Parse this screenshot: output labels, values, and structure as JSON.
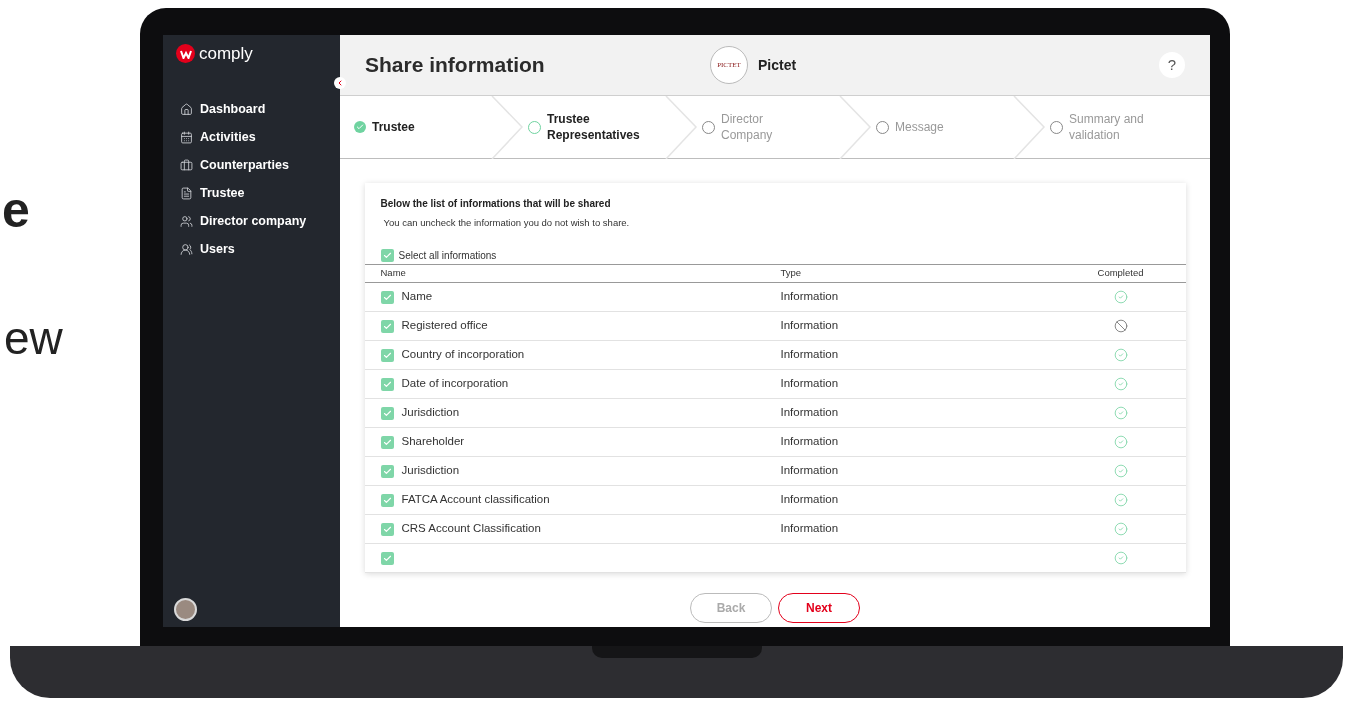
{
  "backdrop_text": [
    "e",
    "ew"
  ],
  "app": {
    "logo_text": "comply"
  },
  "sidebar": {
    "items": [
      {
        "label": "Dashboard"
      },
      {
        "label": "Activities"
      },
      {
        "label": "Counterparties"
      },
      {
        "label": "Trustee"
      },
      {
        "label": "Director company"
      },
      {
        "label": "Users"
      }
    ]
  },
  "header": {
    "title": "Share information",
    "client_logo_text": "PICTET",
    "client_name": "Pictet",
    "help": "?"
  },
  "steps": [
    {
      "label": "Trustee",
      "completed": true,
      "selected": false
    },
    {
      "label": "Trustee Representatives",
      "completed": false,
      "selected": true
    },
    {
      "label": "Director Company",
      "completed": false,
      "selected": false
    },
    {
      "label": "Message",
      "completed": false,
      "selected": false
    },
    {
      "label": "Summary and validation",
      "completed": false,
      "selected": false
    }
  ],
  "card": {
    "title": "Below the list of informations that will be shared",
    "subtitle": "You can uncheck the information you do not wish to share.",
    "select_all": {
      "label": "Select all informations",
      "checked": true
    }
  },
  "table": {
    "columns": [
      "Name",
      "Type",
      "Completed"
    ],
    "rows": [
      {
        "name": "Name",
        "type": "Information",
        "checked": true,
        "completed": true
      },
      {
        "name": "Registered office",
        "type": "Information",
        "checked": true,
        "completed": false
      },
      {
        "name": "Country of incorporation",
        "type": "Information",
        "checked": true,
        "completed": true
      },
      {
        "name": "Date of incorporation",
        "type": "Information",
        "checked": true,
        "completed": true
      },
      {
        "name": "Jurisdiction",
        "type": "Information",
        "checked": true,
        "completed": true
      },
      {
        "name": "Shareholder",
        "type": "Information",
        "checked": true,
        "completed": true
      },
      {
        "name": "Jurisdiction",
        "type": "Information",
        "checked": true,
        "completed": true
      },
      {
        "name": "FATCA Account classification",
        "type": "Information",
        "checked": true,
        "completed": true
      },
      {
        "name": "CRS Account Classification",
        "type": "Information",
        "checked": true,
        "completed": true
      },
      {
        "checked": true,
        "completed": true
      }
    ]
  },
  "buttons": [
    {
      "label": "Back",
      "disabled": true
    },
    {
      "label": "Next",
      "disabled": false
    }
  ]
}
